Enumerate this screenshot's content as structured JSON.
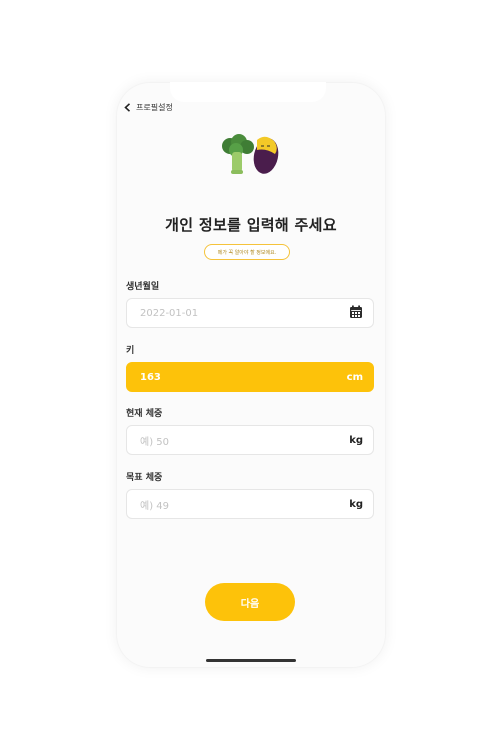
{
  "header": {
    "back_label": "프로필설정"
  },
  "title": "개인 정보를 입력해 주세요",
  "notice": "메가 꼭 알아야 할 정보에요.",
  "fields": [
    {
      "label": "생년월일",
      "value": "2022-01-01",
      "icon": "calendar-icon"
    },
    {
      "label": "키",
      "value": "163",
      "unit": "cm",
      "active": true
    },
    {
      "label": "현재 체중",
      "placeholder": "예) 50",
      "unit": "kg"
    },
    {
      "label": "목표 체중",
      "placeholder": "예) 49",
      "unit": "kg"
    }
  ],
  "next_button": "다음",
  "colors": {
    "accent": "#fdc20a",
    "border": "#e6e6e6",
    "placeholder": "#c2c2c2"
  }
}
